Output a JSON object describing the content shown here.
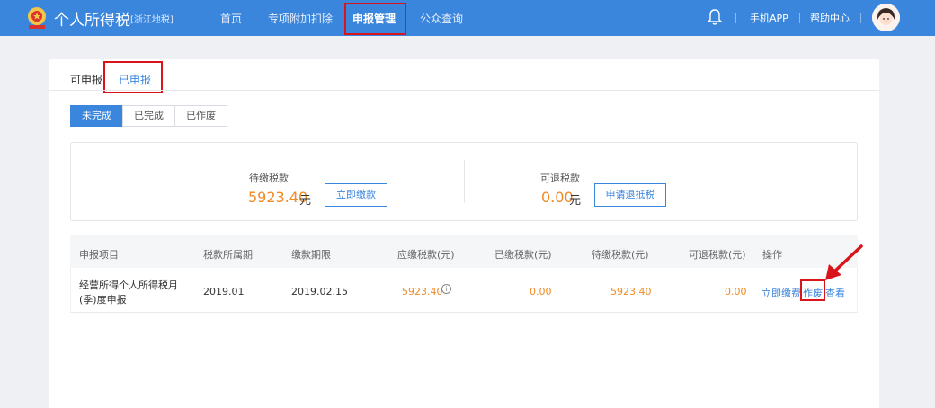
{
  "header": {
    "title": "个人所得税",
    "region": "[浙江地税]",
    "nav": [
      "首页",
      "专项附加扣除",
      "申报管理",
      "公众查询"
    ],
    "app_link": "手机APP",
    "help_link": "帮助中心"
  },
  "tabs": [
    "可申报",
    "已申报"
  ],
  "filters": [
    "未完成",
    "已完成",
    "已作废"
  ],
  "summary": {
    "pending_label": "待缴税款",
    "pending_value": "5923.40",
    "pending_unit": "元",
    "pay_button": "立即缴款",
    "refund_label": "可退税款",
    "refund_value": "0.00",
    "refund_unit": "元",
    "refund_button": "申请退抵税"
  },
  "table": {
    "headers": [
      "申报项目",
      "税款所属期",
      "缴款期限",
      "应缴税款(元)",
      "已缴税款(元)",
      "待缴税款(元)",
      "可退税款(元)",
      "操作"
    ],
    "rows": [
      {
        "item_line1": "经营所得个人所得税月",
        "item_line2": "(季)度申报",
        "period": "2019.01",
        "deadline": "2019.02.15",
        "due": "5923.40",
        "paid": "0.00",
        "pending": "5923.40",
        "refundable": "0.00",
        "actions": [
          "立即缴费",
          "作废",
          "查看"
        ]
      }
    ]
  },
  "colors": {
    "brand": "#3b86dd",
    "amount": "#f08a24",
    "highlight": "#d9151b"
  }
}
